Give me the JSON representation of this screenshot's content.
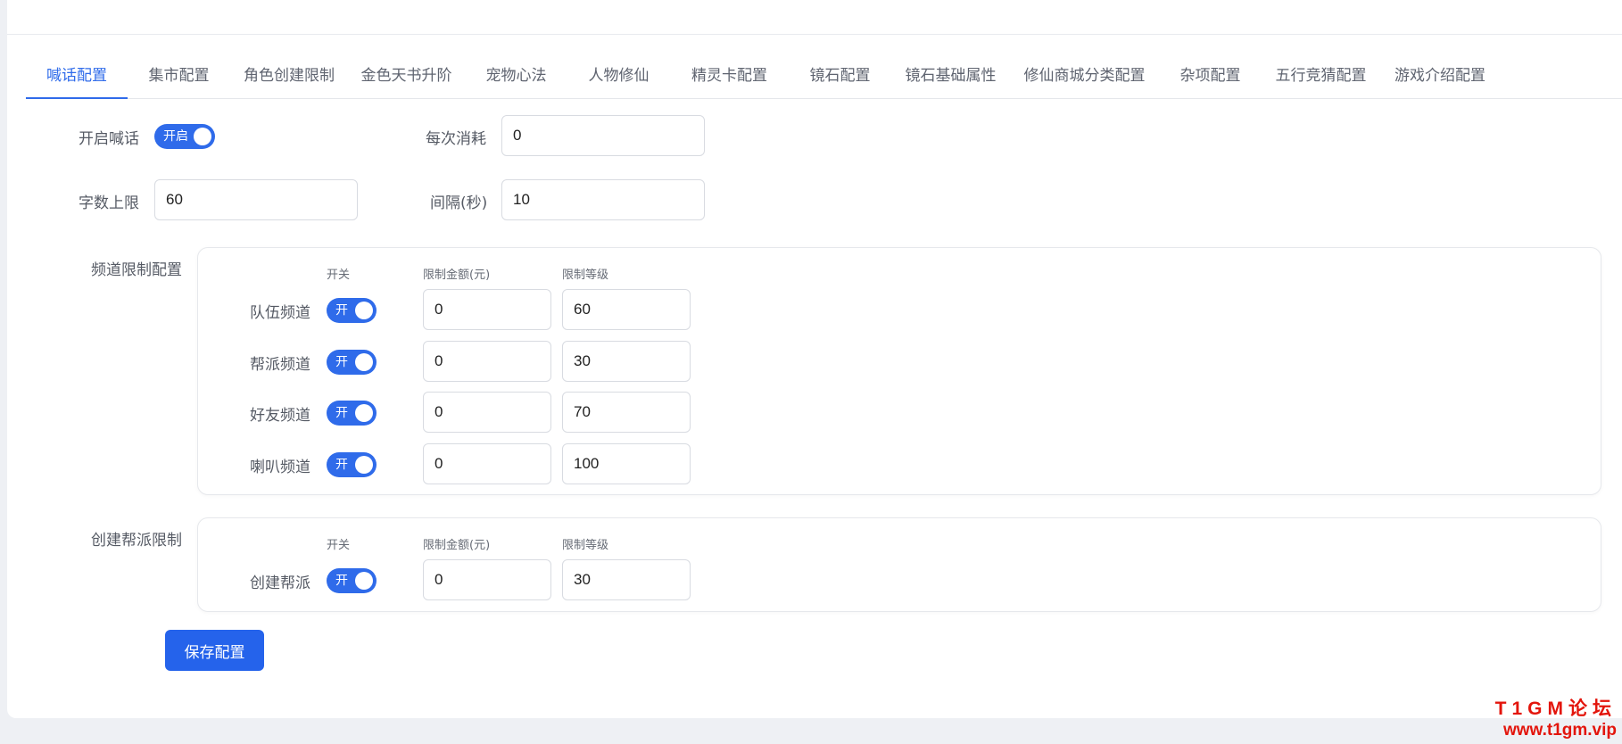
{
  "tabs": [
    {
      "label": "喊话配置",
      "active": true
    },
    {
      "label": "集市配置"
    },
    {
      "label": "角色创建限制"
    },
    {
      "label": "金色天书升阶"
    },
    {
      "label": "宠物心法"
    },
    {
      "label": "人物修仙"
    },
    {
      "label": "精灵卡配置"
    },
    {
      "label": "镜石配置"
    },
    {
      "label": "镜石基础属性"
    },
    {
      "label": "修仙商城分类配置"
    },
    {
      "label": "杂项配置"
    },
    {
      "label": "五行竞猜配置"
    },
    {
      "label": "游戏介绍配置"
    }
  ],
  "general": {
    "enable_label": "开启喊话",
    "enable_switch_text": "开启",
    "cost_label": "每次消耗",
    "cost_value": "0",
    "max_chars_label": "字数上限",
    "max_chars_value": "60",
    "interval_label": "间隔(秒)",
    "interval_value": "10"
  },
  "channel_limits": {
    "section_label": "频道限制配置",
    "col_switch": "开关",
    "col_amount": "限制金额(元)",
    "col_level": "限制等级",
    "rows": [
      {
        "name": "队伍频道",
        "switch_text": "开",
        "amount": "0",
        "level": "60"
      },
      {
        "name": "帮派频道",
        "switch_text": "开",
        "amount": "0",
        "level": "30"
      },
      {
        "name": "好友频道",
        "switch_text": "开",
        "amount": "0",
        "level": "70"
      },
      {
        "name": "喇叭频道",
        "switch_text": "开",
        "amount": "0",
        "level": "100"
      }
    ]
  },
  "guild_limits": {
    "section_label": "创建帮派限制",
    "col_switch": "开关",
    "col_amount": "限制金额(元)",
    "col_level": "限制等级",
    "rows": [
      {
        "name": "创建帮派",
        "switch_text": "开",
        "amount": "0",
        "level": "30"
      }
    ]
  },
  "save_button": "保存配置",
  "watermark": {
    "line1": "T1GM论坛",
    "line2": "www.t1gm.vip"
  },
  "colors": {
    "accent": "#2f6bea",
    "watermark": "#e3150c"
  }
}
